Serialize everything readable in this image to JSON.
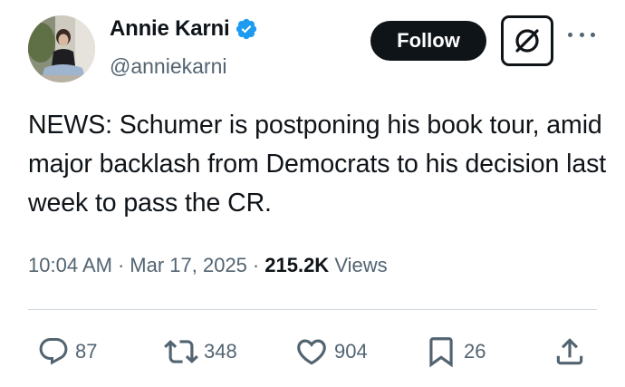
{
  "author": {
    "display_name": "Annie Karni",
    "handle": "@anniekarni",
    "verified": true,
    "verified_color": "#1d9bf0"
  },
  "header": {
    "follow_label": "Follow",
    "grok_icon": "grok-icon",
    "more_icon": "more-icon"
  },
  "tweet": {
    "text": "NEWS: Schumer is postponing his book tour, amid major backlash from Democrats to his decision last week to pass the CR."
  },
  "meta": {
    "time": "10:04 AM",
    "date": "Mar 17, 2025",
    "views_count": "215.2K",
    "views_label": "Views"
  },
  "actions": {
    "replies": "87",
    "reposts": "348",
    "likes": "904",
    "bookmarks": "26",
    "share_icon": "share-icon"
  },
  "colors": {
    "text_primary": "#0f1419",
    "text_secondary": "#536471",
    "divider": "#cfd9de"
  }
}
